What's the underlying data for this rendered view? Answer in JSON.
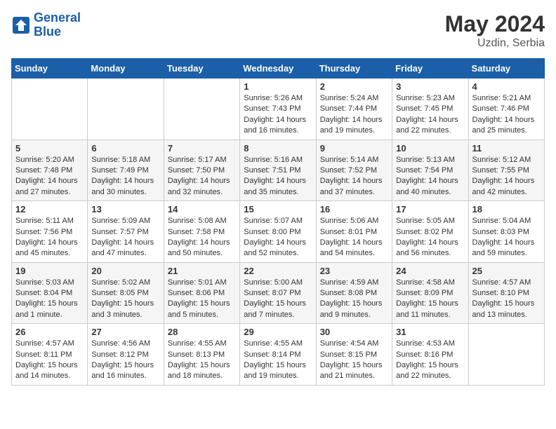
{
  "header": {
    "logo_line1": "General",
    "logo_line2": "Blue",
    "month": "May 2024",
    "location": "Uzdin, Serbia"
  },
  "weekdays": [
    "Sunday",
    "Monday",
    "Tuesday",
    "Wednesday",
    "Thursday",
    "Friday",
    "Saturday"
  ],
  "weeks": [
    [
      {
        "day": "",
        "info": ""
      },
      {
        "day": "",
        "info": ""
      },
      {
        "day": "",
        "info": ""
      },
      {
        "day": "1",
        "info": "Sunrise: 5:26 AM\nSunset: 7:43 PM\nDaylight: 14 hours\nand 16 minutes."
      },
      {
        "day": "2",
        "info": "Sunrise: 5:24 AM\nSunset: 7:44 PM\nDaylight: 14 hours\nand 19 minutes."
      },
      {
        "day": "3",
        "info": "Sunrise: 5:23 AM\nSunset: 7:45 PM\nDaylight: 14 hours\nand 22 minutes."
      },
      {
        "day": "4",
        "info": "Sunrise: 5:21 AM\nSunset: 7:46 PM\nDaylight: 14 hours\nand 25 minutes."
      }
    ],
    [
      {
        "day": "5",
        "info": "Sunrise: 5:20 AM\nSunset: 7:48 PM\nDaylight: 14 hours\nand 27 minutes."
      },
      {
        "day": "6",
        "info": "Sunrise: 5:18 AM\nSunset: 7:49 PM\nDaylight: 14 hours\nand 30 minutes."
      },
      {
        "day": "7",
        "info": "Sunrise: 5:17 AM\nSunset: 7:50 PM\nDaylight: 14 hours\nand 32 minutes."
      },
      {
        "day": "8",
        "info": "Sunrise: 5:16 AM\nSunset: 7:51 PM\nDaylight: 14 hours\nand 35 minutes."
      },
      {
        "day": "9",
        "info": "Sunrise: 5:14 AM\nSunset: 7:52 PM\nDaylight: 14 hours\nand 37 minutes."
      },
      {
        "day": "10",
        "info": "Sunrise: 5:13 AM\nSunset: 7:54 PM\nDaylight: 14 hours\nand 40 minutes."
      },
      {
        "day": "11",
        "info": "Sunrise: 5:12 AM\nSunset: 7:55 PM\nDaylight: 14 hours\nand 42 minutes."
      }
    ],
    [
      {
        "day": "12",
        "info": "Sunrise: 5:11 AM\nSunset: 7:56 PM\nDaylight: 14 hours\nand 45 minutes."
      },
      {
        "day": "13",
        "info": "Sunrise: 5:09 AM\nSunset: 7:57 PM\nDaylight: 14 hours\nand 47 minutes."
      },
      {
        "day": "14",
        "info": "Sunrise: 5:08 AM\nSunset: 7:58 PM\nDaylight: 14 hours\nand 50 minutes."
      },
      {
        "day": "15",
        "info": "Sunrise: 5:07 AM\nSunset: 8:00 PM\nDaylight: 14 hours\nand 52 minutes."
      },
      {
        "day": "16",
        "info": "Sunrise: 5:06 AM\nSunset: 8:01 PM\nDaylight: 14 hours\nand 54 minutes."
      },
      {
        "day": "17",
        "info": "Sunrise: 5:05 AM\nSunset: 8:02 PM\nDaylight: 14 hours\nand 56 minutes."
      },
      {
        "day": "18",
        "info": "Sunrise: 5:04 AM\nSunset: 8:03 PM\nDaylight: 14 hours\nand 59 minutes."
      }
    ],
    [
      {
        "day": "19",
        "info": "Sunrise: 5:03 AM\nSunset: 8:04 PM\nDaylight: 15 hours\nand 1 minute."
      },
      {
        "day": "20",
        "info": "Sunrise: 5:02 AM\nSunset: 8:05 PM\nDaylight: 15 hours\nand 3 minutes."
      },
      {
        "day": "21",
        "info": "Sunrise: 5:01 AM\nSunset: 8:06 PM\nDaylight: 15 hours\nand 5 minutes."
      },
      {
        "day": "22",
        "info": "Sunrise: 5:00 AM\nSunset: 8:07 PM\nDaylight: 15 hours\nand 7 minutes."
      },
      {
        "day": "23",
        "info": "Sunrise: 4:59 AM\nSunset: 8:08 PM\nDaylight: 15 hours\nand 9 minutes."
      },
      {
        "day": "24",
        "info": "Sunrise: 4:58 AM\nSunset: 8:09 PM\nDaylight: 15 hours\nand 11 minutes."
      },
      {
        "day": "25",
        "info": "Sunrise: 4:57 AM\nSunset: 8:10 PM\nDaylight: 15 hours\nand 13 minutes."
      }
    ],
    [
      {
        "day": "26",
        "info": "Sunrise: 4:57 AM\nSunset: 8:11 PM\nDaylight: 15 hours\nand 14 minutes."
      },
      {
        "day": "27",
        "info": "Sunrise: 4:56 AM\nSunset: 8:12 PM\nDaylight: 15 hours\nand 16 minutes."
      },
      {
        "day": "28",
        "info": "Sunrise: 4:55 AM\nSunset: 8:13 PM\nDaylight: 15 hours\nand 18 minutes."
      },
      {
        "day": "29",
        "info": "Sunrise: 4:55 AM\nSunset: 8:14 PM\nDaylight: 15 hours\nand 19 minutes."
      },
      {
        "day": "30",
        "info": "Sunrise: 4:54 AM\nSunset: 8:15 PM\nDaylight: 15 hours\nand 21 minutes."
      },
      {
        "day": "31",
        "info": "Sunrise: 4:53 AM\nSunset: 8:16 PM\nDaylight: 15 hours\nand 22 minutes."
      },
      {
        "day": "",
        "info": ""
      }
    ]
  ]
}
